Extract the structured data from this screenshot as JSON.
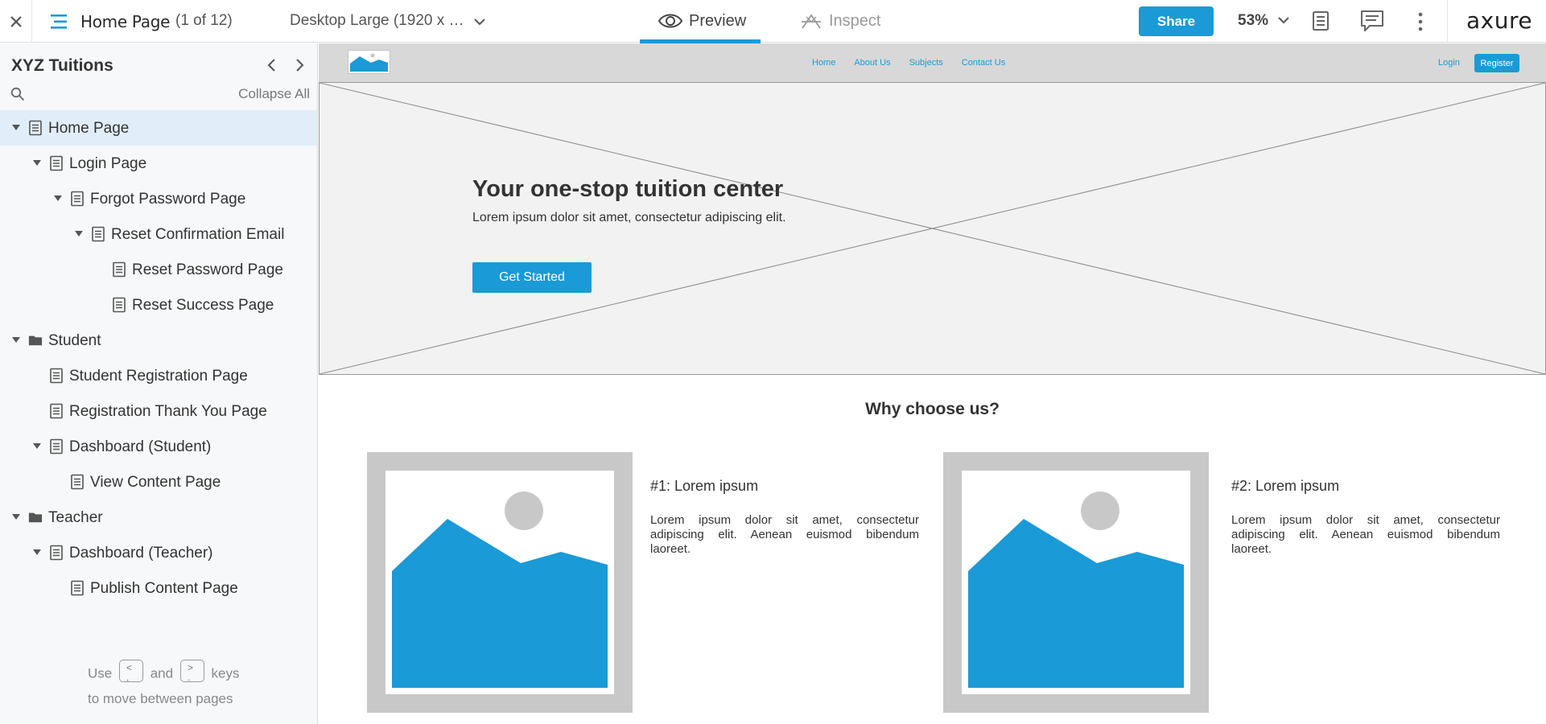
{
  "topbar": {
    "page_title": "Home Page",
    "page_count": "(1 of 12)",
    "device": "Desktop Large (1920 x …",
    "tabs": {
      "preview": "Preview",
      "inspect": "Inspect"
    },
    "share_label": "Share",
    "zoom": "53%",
    "brand": "axure"
  },
  "sidebar": {
    "project_title": "XYZ Tuitions",
    "collapse_all": "Collapse All",
    "items": [
      {
        "label": "Home Page",
        "type": "page",
        "level": 0,
        "expanded": true,
        "selected": true
      },
      {
        "label": "Login Page",
        "type": "page",
        "level": 1,
        "expanded": true
      },
      {
        "label": "Forgot Password Page",
        "type": "page",
        "level": 2,
        "expanded": true
      },
      {
        "label": "Reset Confirmation Email",
        "type": "page",
        "level": 3,
        "expanded": true
      },
      {
        "label": "Reset Password Page",
        "type": "page",
        "level": 4
      },
      {
        "label": "Reset Success Page",
        "type": "page",
        "level": 4
      },
      {
        "label": "Student",
        "type": "folder",
        "level": 0,
        "expanded": true
      },
      {
        "label": "Student Registration Page",
        "type": "page",
        "level": 1
      },
      {
        "label": "Registration Thank You Page",
        "type": "page",
        "level": 1
      },
      {
        "label": "Dashboard (Student)",
        "type": "page",
        "level": 1,
        "expanded": true
      },
      {
        "label": "View Content Page",
        "type": "page",
        "level": 2
      },
      {
        "label": "Teacher",
        "type": "folder",
        "level": 0,
        "expanded": true
      },
      {
        "label": "Dashboard (Teacher)",
        "type": "page",
        "level": 1,
        "expanded": true
      },
      {
        "label": "Publish Content Page",
        "type": "page",
        "level": 2
      }
    ],
    "hint": {
      "use": "Use",
      "key_prev_top": "<",
      "key_prev_bottom": ",",
      "and": "and",
      "key_next_top": ">",
      "key_next_bottom": ".",
      "keys": "keys",
      "line2": "to move between pages"
    }
  },
  "preview": {
    "nav": {
      "links": [
        "Home",
        "About Us",
        "Subjects",
        "Contact Us"
      ],
      "login": "Login",
      "register": "Register"
    },
    "hero": {
      "title": "Your one-stop tuition center",
      "subtitle": "Lorem ipsum dolor sit amet, consectetur adipiscing elit.",
      "cta": "Get Started"
    },
    "why_title": "Why choose us?",
    "cards": [
      {
        "title": "#1: Lorem ipsum",
        "text": "Lorem ipsum dolor sit amet, consectetur adipiscing elit. Aenean euismod bibendum laoreet."
      },
      {
        "title": "#2: Lorem ipsum",
        "text": "Lorem ipsum dolor sit amet, consectetur adipiscing elit. Aenean euismod bibendum laoreet."
      }
    ]
  },
  "colors": {
    "accent": "#1a9ad6",
    "selected_row": "#e1eefa",
    "sidebar_bg": "#f7f8fa",
    "placeholder_gray": "#c8c8c8"
  },
  "icons": [
    "close-icon",
    "menu-icon",
    "chevron-down-icon",
    "eye-icon",
    "inspect-icon",
    "notes-icon",
    "comments-icon",
    "more-icon",
    "chevron-left-icon",
    "chevron-right-icon",
    "search-icon",
    "page-icon",
    "folder-icon",
    "expand-triangle-icon",
    "image-placeholder-icon"
  ]
}
